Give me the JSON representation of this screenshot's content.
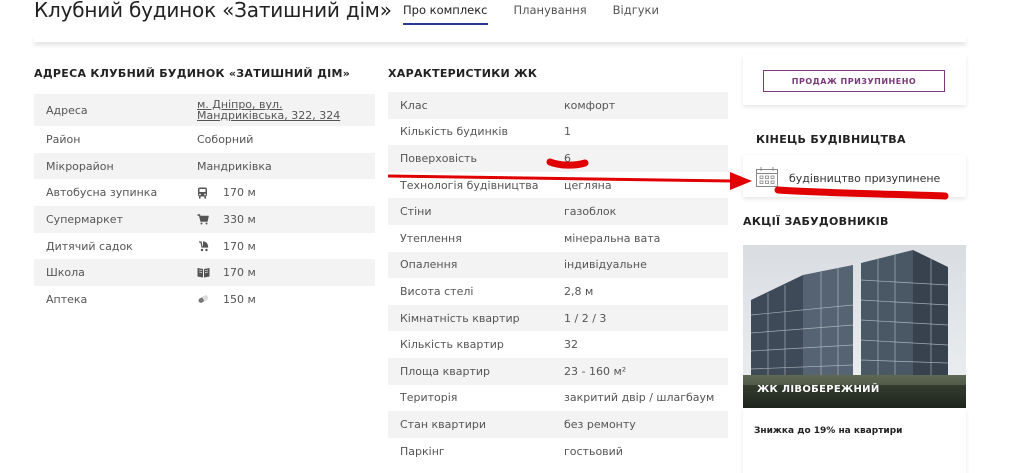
{
  "header": {
    "title": "Клубний будинок «Затишний дім»",
    "tabs": [
      {
        "label": "Про комплекс",
        "active": true
      },
      {
        "label": "Планування",
        "active": false
      },
      {
        "label": "Відгуки",
        "active": false
      }
    ]
  },
  "address": {
    "title": "АДРЕСА КЛУБНИЙ БУДИНОК «ЗАТИШНИЙ ДІМ»",
    "rows": [
      {
        "label": "Адреса",
        "value": "м. Дніпро, вул. Мандриківська, 322, 324",
        "icon": ""
      },
      {
        "label": "Район",
        "value": "Соборний",
        "icon": ""
      },
      {
        "label": "Мікрорайон",
        "value": "Мандриківка",
        "icon": ""
      },
      {
        "label": "Автобусна зупинка",
        "value": "170 м",
        "icon": "bus-icon"
      },
      {
        "label": "Супермаркет",
        "value": "330 м",
        "icon": "cart-icon"
      },
      {
        "label": "Дитячий садок",
        "value": "170 м",
        "icon": "stroller-icon"
      },
      {
        "label": "Школа",
        "value": "170 м",
        "icon": "book-icon"
      },
      {
        "label": "Аптека",
        "value": "150 м",
        "icon": "pill-icon"
      }
    ]
  },
  "characteristics": {
    "title": "ХАРАКТЕРИСТИКИ ЖК",
    "rows": [
      {
        "label": "Клас",
        "value": "комфорт"
      },
      {
        "label": "Кількість будинків",
        "value": "1"
      },
      {
        "label": "Поверховість",
        "value": "6"
      },
      {
        "label": "Технологія будівництва",
        "value": "цегляна"
      },
      {
        "label": "Стіни",
        "value": "газоблок"
      },
      {
        "label": "Утеплення",
        "value": "мінеральна вата"
      },
      {
        "label": "Опалення",
        "value": "індивідуальне"
      },
      {
        "label": "Висота стелі",
        "value": "2,8 м"
      },
      {
        "label": "Кімнатність квартир",
        "value": "1 / 2 / 3"
      },
      {
        "label": "Кількість квартир",
        "value": "32"
      },
      {
        "label": "Площа квартир",
        "value": "23 - 160 м²"
      },
      {
        "label": "Територія",
        "value": "закритий двір / шлагбаум"
      },
      {
        "label": "Стан квартири",
        "value": "без ремонту"
      },
      {
        "label": "Паркінг",
        "value": "гостьовий"
      }
    ]
  },
  "sidebar": {
    "sale_button": "ПРОДАЖ ПРИЗУПИНЕНО",
    "end_title": "КІНЕЦЬ БУДІВНИЦТВА",
    "end_status": "будівництво призупинене",
    "promo_title": "АКЦІЇ ЗАБУДОВНИКІВ",
    "promo_image_label": "ЖК ЛІВОБЕРЕЖНИЙ",
    "promo_text": "Знижка до 19% на квартири"
  },
  "colors": {
    "accent": "#2b3a8c",
    "sale_border": "#7a3a7a",
    "annotation": "#e00000"
  }
}
